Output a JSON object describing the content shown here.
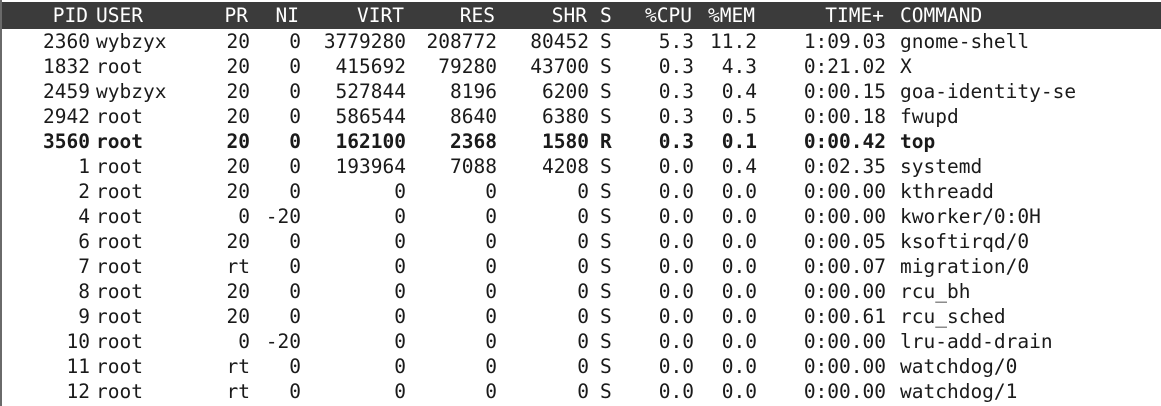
{
  "columns": [
    {
      "key": "pid",
      "label": "PID"
    },
    {
      "key": "user",
      "label": "USER"
    },
    {
      "key": "pr",
      "label": "PR"
    },
    {
      "key": "ni",
      "label": "NI"
    },
    {
      "key": "virt",
      "label": "VIRT"
    },
    {
      "key": "res",
      "label": "RES"
    },
    {
      "key": "shr",
      "label": "SHR"
    },
    {
      "key": "s",
      "label": "S"
    },
    {
      "key": "cpu",
      "label": "%CPU"
    },
    {
      "key": "mem",
      "label": "%MEM"
    },
    {
      "key": "time",
      "label": "TIME+"
    },
    {
      "key": "command",
      "label": "COMMAND"
    }
  ],
  "processes": [
    {
      "pid": "2360",
      "user": "wybzyx",
      "pr": "20",
      "ni": "0",
      "virt": "3779280",
      "res": "208772",
      "shr": "80452",
      "s": "S",
      "cpu": "5.3",
      "mem": "11.2",
      "time": "1:09.03",
      "command": "gnome-shell",
      "bold": false
    },
    {
      "pid": "1832",
      "user": "root",
      "pr": "20",
      "ni": "0",
      "virt": "415692",
      "res": "79280",
      "shr": "43700",
      "s": "S",
      "cpu": "0.3",
      "mem": "4.3",
      "time": "0:21.02",
      "command": "X",
      "bold": false
    },
    {
      "pid": "2459",
      "user": "wybzyx",
      "pr": "20",
      "ni": "0",
      "virt": "527844",
      "res": "8196",
      "shr": "6200",
      "s": "S",
      "cpu": "0.3",
      "mem": "0.4",
      "time": "0:00.15",
      "command": "goa-identity-se",
      "bold": false
    },
    {
      "pid": "2942",
      "user": "root",
      "pr": "20",
      "ni": "0",
      "virt": "586544",
      "res": "8640",
      "shr": "6380",
      "s": "S",
      "cpu": "0.3",
      "mem": "0.5",
      "time": "0:00.18",
      "command": "fwupd",
      "bold": false
    },
    {
      "pid": "3560",
      "user": "root",
      "pr": "20",
      "ni": "0",
      "virt": "162100",
      "res": "2368",
      "shr": "1580",
      "s": "R",
      "cpu": "0.3",
      "mem": "0.1",
      "time": "0:00.42",
      "command": "top",
      "bold": true
    },
    {
      "pid": "1",
      "user": "root",
      "pr": "20",
      "ni": "0",
      "virt": "193964",
      "res": "7088",
      "shr": "4208",
      "s": "S",
      "cpu": "0.0",
      "mem": "0.4",
      "time": "0:02.35",
      "command": "systemd",
      "bold": false
    },
    {
      "pid": "2",
      "user": "root",
      "pr": "20",
      "ni": "0",
      "virt": "0",
      "res": "0",
      "shr": "0",
      "s": "S",
      "cpu": "0.0",
      "mem": "0.0",
      "time": "0:00.00",
      "command": "kthreadd",
      "bold": false
    },
    {
      "pid": "4",
      "user": "root",
      "pr": "0",
      "ni": "-20",
      "virt": "0",
      "res": "0",
      "shr": "0",
      "s": "S",
      "cpu": "0.0",
      "mem": "0.0",
      "time": "0:00.00",
      "command": "kworker/0:0H",
      "bold": false
    },
    {
      "pid": "6",
      "user": "root",
      "pr": "20",
      "ni": "0",
      "virt": "0",
      "res": "0",
      "shr": "0",
      "s": "S",
      "cpu": "0.0",
      "mem": "0.0",
      "time": "0:00.05",
      "command": "ksoftirqd/0",
      "bold": false
    },
    {
      "pid": "7",
      "user": "root",
      "pr": "rt",
      "ni": "0",
      "virt": "0",
      "res": "0",
      "shr": "0",
      "s": "S",
      "cpu": "0.0",
      "mem": "0.0",
      "time": "0:00.07",
      "command": "migration/0",
      "bold": false
    },
    {
      "pid": "8",
      "user": "root",
      "pr": "20",
      "ni": "0",
      "virt": "0",
      "res": "0",
      "shr": "0",
      "s": "S",
      "cpu": "0.0",
      "mem": "0.0",
      "time": "0:00.00",
      "command": "rcu_bh",
      "bold": false
    },
    {
      "pid": "9",
      "user": "root",
      "pr": "20",
      "ni": "0",
      "virt": "0",
      "res": "0",
      "shr": "0",
      "s": "S",
      "cpu": "0.0",
      "mem": "0.0",
      "time": "0:00.61",
      "command": "rcu_sched",
      "bold": false
    },
    {
      "pid": "10",
      "user": "root",
      "pr": "0",
      "ni": "-20",
      "virt": "0",
      "res": "0",
      "shr": "0",
      "s": "S",
      "cpu": "0.0",
      "mem": "0.0",
      "time": "0:00.00",
      "command": "lru-add-drain",
      "bold": false
    },
    {
      "pid": "11",
      "user": "root",
      "pr": "rt",
      "ni": "0",
      "virt": "0",
      "res": "0",
      "shr": "0",
      "s": "S",
      "cpu": "0.0",
      "mem": "0.0",
      "time": "0:00.00",
      "command": "watchdog/0",
      "bold": false
    },
    {
      "pid": "12",
      "user": "root",
      "pr": "rt",
      "ni": "0",
      "virt": "0",
      "res": "0",
      "shr": "0",
      "s": "S",
      "cpu": "0.0",
      "mem": "0.0",
      "time": "0:00.00",
      "command": "watchdog/1",
      "bold": false
    }
  ],
  "colors": {
    "header_bg": "#3b3b3b",
    "header_fg": "#ffffff",
    "text": "#1a1a1a",
    "background": "#ffffff"
  }
}
